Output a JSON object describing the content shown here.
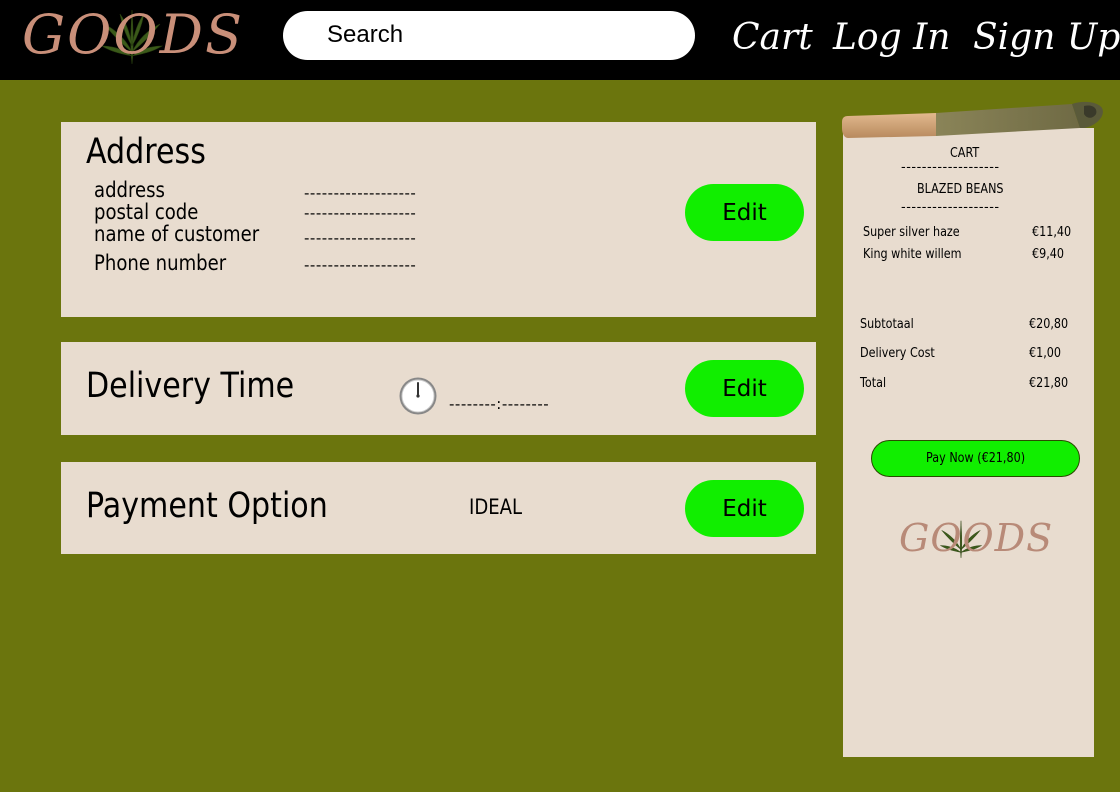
{
  "header": {
    "logo_text": "GOODS",
    "search_placeholder": "Search",
    "nav": {
      "cart": "Cart",
      "login": "Log In",
      "signup": "Sign Up"
    }
  },
  "address": {
    "title": "Address",
    "fields": [
      {
        "label": "address",
        "value": "-------------------"
      },
      {
        "label": "postal code",
        "value": "-------------------"
      },
      {
        "label": "name of customer",
        "value": "-------------------"
      },
      {
        "label": "Phone number",
        "value": "-------------------"
      }
    ],
    "edit_label": "Edit"
  },
  "delivery": {
    "title": "Delivery Time",
    "time_value": "--------:--------",
    "edit_label": "Edit"
  },
  "payment": {
    "title": "Payment Option",
    "value": "IDEAL",
    "edit_label": "Edit"
  },
  "cart": {
    "heading": "CART",
    "store_name": "BLAZED BEANS",
    "separator": "-------------------",
    "items": [
      {
        "name": "Super silver haze",
        "price": "€11,40"
      },
      {
        "name": "King white willem",
        "price": "€9,40"
      }
    ],
    "summary": [
      {
        "label": "Subtotaal",
        "value": "€20,80"
      },
      {
        "label": "Delivery Cost",
        "value": "€1,00"
      },
      {
        "label": "Total",
        "value": "€21,80"
      }
    ],
    "pay_label": "Pay Now (€21,80)",
    "logo_text": "GOODS"
  },
  "colors": {
    "background": "#6b750d",
    "header": "#000000",
    "card": "#e8dccf",
    "accent_green": "#11ee00",
    "logo": "#c98f79"
  },
  "icons": [
    "cannabis-leaf-icon",
    "clock-icon",
    "joint-image"
  ]
}
